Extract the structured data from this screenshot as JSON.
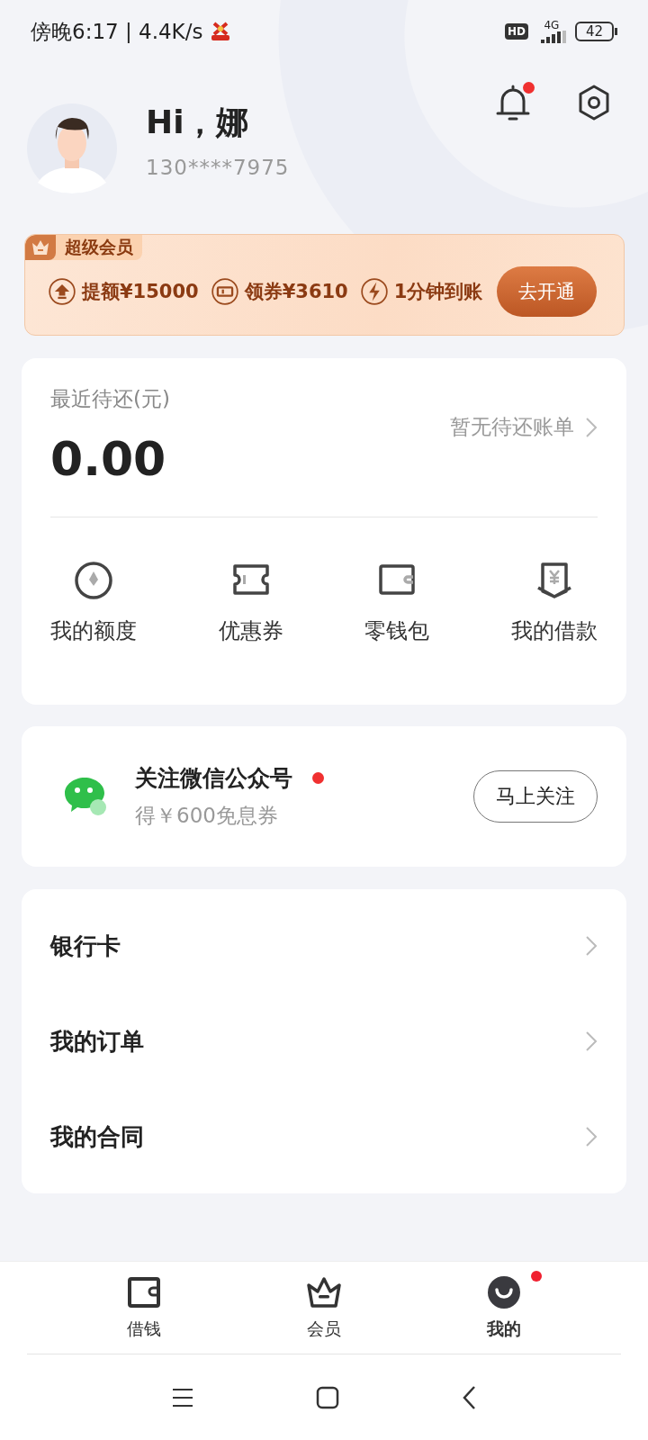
{
  "status_bar": {
    "time": "傍晚6:17 | 4.4K/s",
    "hd": "HD",
    "network": "4G",
    "battery": "42"
  },
  "profile": {
    "greeting": "Hi，娜",
    "phone": "130****7975",
    "unread": true
  },
  "vip_banner": {
    "badge": "超级会员",
    "perks": [
      {
        "kind": "raise",
        "text": "提额¥15000"
      },
      {
        "kind": "coupon",
        "text": "领券¥3610"
      },
      {
        "kind": "fast",
        "text": "1分钟到账"
      }
    ],
    "button": "去开通"
  },
  "repayment": {
    "label": "最近待还(元)",
    "amount": "0.00",
    "link": "暂无待还账单",
    "shortcuts": [
      {
        "kind": "quota",
        "label": "我的额度"
      },
      {
        "kind": "coupon",
        "label": "优惠券"
      },
      {
        "kind": "wallet",
        "label": "零钱包"
      },
      {
        "kind": "loan",
        "label": "我的借款"
      }
    ]
  },
  "wechat": {
    "title": "关注微信公众号",
    "unread": true,
    "subtitle": "得￥600免息券",
    "button": "马上关注"
  },
  "menu": [
    {
      "label": "银行卡"
    },
    {
      "label": "我的订单"
    },
    {
      "label": "我的合同"
    }
  ],
  "tabs": [
    {
      "kind": "wallet",
      "label": "借钱",
      "selected": false,
      "unread": false
    },
    {
      "kind": "crown",
      "label": "会员",
      "selected": false,
      "unread": false
    },
    {
      "kind": "me",
      "label": "我的",
      "selected": true,
      "unread": true
    }
  ]
}
